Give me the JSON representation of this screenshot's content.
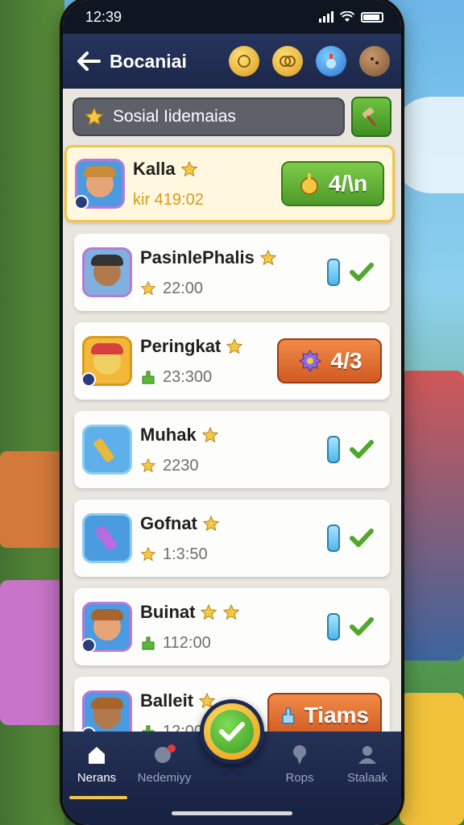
{
  "status_bar": {
    "time": "12:39"
  },
  "header": {
    "title": "Bocaniai",
    "icons": [
      "coin-icon",
      "coins-icon",
      "potion-icon",
      "cookie-icon"
    ]
  },
  "search": {
    "value": "Sosial Iidemaias"
  },
  "rows": [
    {
      "name": "Kalla",
      "stars": 1,
      "sub": "kir 419:02",
      "action": {
        "type": "button",
        "label": "4/\\n",
        "icon": "bell-icon",
        "color": "green"
      }
    },
    {
      "name": "PasinlePhalis",
      "stars": 1,
      "sub": "22:00",
      "sub_icon": "star-icon",
      "action": {
        "type": "check"
      }
    },
    {
      "name": "Peringkat",
      "stars": 1,
      "sub": "23:300",
      "sub_icon": "hand-icon",
      "action": {
        "type": "button",
        "label": "4/3",
        "icon": "gear-icon",
        "color": "orange"
      }
    },
    {
      "name": "Muhak",
      "stars": 1,
      "sub": "2230",
      "sub_icon": "star-icon",
      "action": {
        "type": "check"
      }
    },
    {
      "name": "Gofnat",
      "stars": 1,
      "sub": "1:3:50",
      "sub_icon": "star-icon",
      "action": {
        "type": "check"
      }
    },
    {
      "name": "Buinat",
      "stars": 2,
      "sub": "112:00",
      "sub_icon": "hand-icon",
      "action": {
        "type": "check"
      }
    },
    {
      "name": "Balleit",
      "stars": 1,
      "sub": "12:00",
      "sub_icon": "hand-icon",
      "action": {
        "type": "button",
        "label": "Tiams",
        "icon": "flag-icon",
        "color": "orange"
      }
    }
  ],
  "nav": [
    {
      "label": "Nerans",
      "icon": "home-icon",
      "active": true
    },
    {
      "label": "Nedemiyy",
      "icon": "chat-icon",
      "active": false
    },
    {
      "label": "Rops",
      "icon": "pin-icon",
      "active": false
    },
    {
      "label": "Stalaak",
      "icon": "user-icon",
      "active": false
    }
  ],
  "colors": {
    "accent": "#f3c448",
    "nav_bg": "#1c2748",
    "green": "#5aaa2f",
    "orange": "#e06a2a"
  }
}
